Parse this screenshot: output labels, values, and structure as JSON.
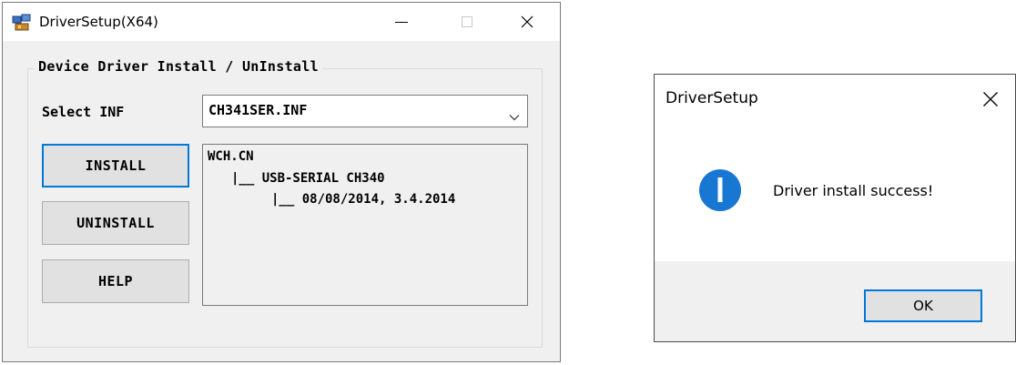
{
  "main_window": {
    "title": "DriverSetup(X64)",
    "group_title": "Device Driver Install / UnInstall",
    "select_label": "Select INF",
    "inf_select": {
      "value": "CH341SER.INF"
    },
    "buttons": {
      "install": "INSTALL",
      "uninstall": "UNINSTALL",
      "help": "HELP"
    },
    "info": {
      "line1": "WCH.CN",
      "line2": "|__ USB-SERIAL CH340",
      "line3": "|__ 08/08/2014, 3.4.2014"
    },
    "icons": {
      "app": "app-driver-icon",
      "minimize": "minimize-icon",
      "maximize": "maximize-icon",
      "close": "close-icon",
      "dropdown": "chevron-down-icon"
    }
  },
  "dialog": {
    "title": "DriverSetup",
    "message": "Driver install success!",
    "ok_label": "OK",
    "icons": {
      "info": "info-icon",
      "close": "close-icon"
    }
  },
  "colors": {
    "accent": "#0078d7",
    "window_bg": "#f0f0f0",
    "button_bg": "#e1e1e1"
  }
}
